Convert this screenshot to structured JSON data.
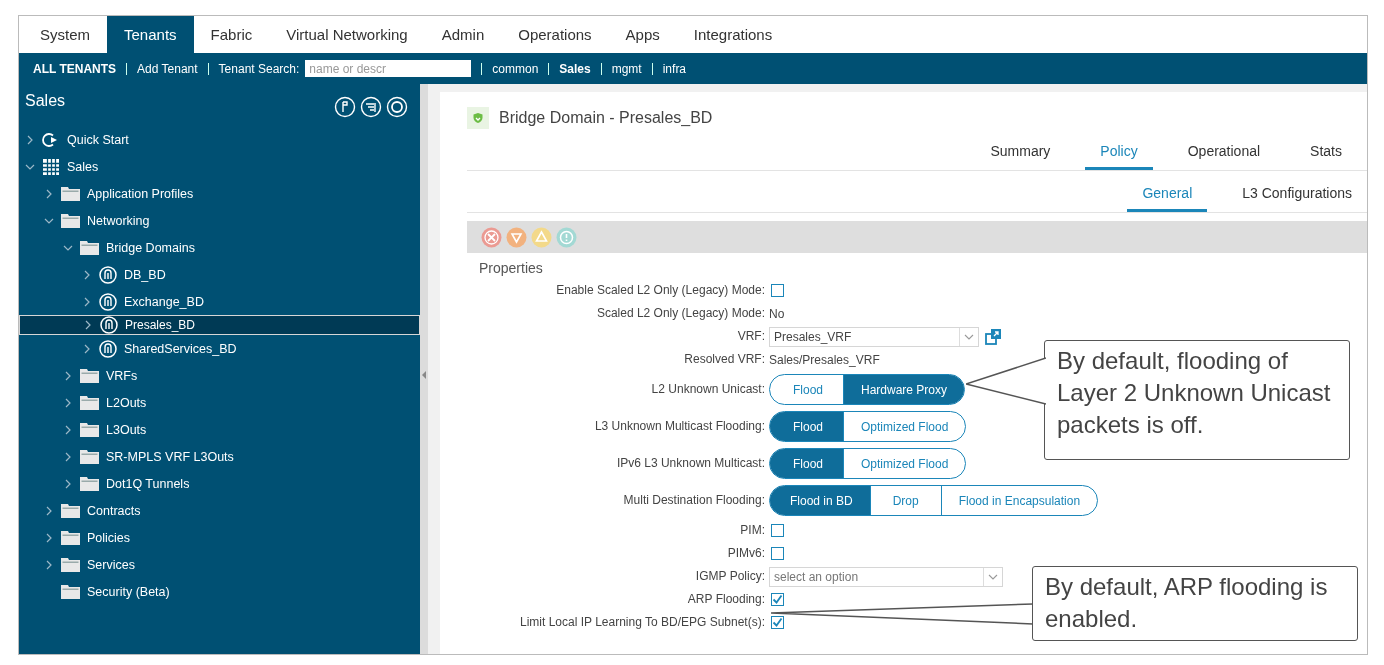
{
  "top_tabs": [
    {
      "label": "System",
      "selected": false
    },
    {
      "label": "Tenants",
      "selected": true
    },
    {
      "label": "Fabric",
      "selected": false
    },
    {
      "label": "Virtual Networking",
      "selected": false
    },
    {
      "label": "Admin",
      "selected": false
    },
    {
      "label": "Operations",
      "selected": false
    },
    {
      "label": "Apps",
      "selected": false
    },
    {
      "label": "Integrations",
      "selected": false
    }
  ],
  "sub_bar": {
    "all_tenants": "ALL TENANTS",
    "add_tenant": "Add Tenant",
    "search_label": "Tenant Search:",
    "search_placeholder": "name or descr",
    "tenants": [
      {
        "label": "common",
        "selected": false
      },
      {
        "label": "Sales",
        "selected": true
      },
      {
        "label": "mgmt",
        "selected": false
      },
      {
        "label": "infra",
        "selected": false
      }
    ]
  },
  "sidebar": {
    "title": "Sales",
    "tree": [
      {
        "label": "Quick Start",
        "kind": "quickstart",
        "expanded": false,
        "selected": false
      },
      {
        "label": "Sales",
        "kind": "tenant",
        "expanded": true,
        "selected": false,
        "children": [
          {
            "label": "Application Profiles",
            "kind": "folder",
            "expanded": false,
            "selected": false
          },
          {
            "label": "Networking",
            "kind": "folder",
            "expanded": true,
            "selected": false,
            "children": [
              {
                "label": "Bridge Domains",
                "kind": "folder",
                "expanded": true,
                "selected": false,
                "children": [
                  {
                    "label": "DB_BD",
                    "kind": "bd",
                    "expanded": false,
                    "selected": false
                  },
                  {
                    "label": "Exchange_BD",
                    "kind": "bd",
                    "expanded": false,
                    "selected": false
                  },
                  {
                    "label": "Presales_BD",
                    "kind": "bd",
                    "expanded": false,
                    "selected": true
                  },
                  {
                    "label": "SharedServices_BD",
                    "kind": "bd",
                    "expanded": false,
                    "selected": false
                  }
                ]
              },
              {
                "label": "VRFs",
                "kind": "folder",
                "expanded": false,
                "selected": false
              },
              {
                "label": "L2Outs",
                "kind": "folder",
                "expanded": false,
                "selected": false
              },
              {
                "label": "L3Outs",
                "kind": "folder",
                "expanded": false,
                "selected": false
              },
              {
                "label": "SR-MPLS VRF L3Outs",
                "kind": "folder",
                "expanded": false,
                "selected": false
              },
              {
                "label": "Dot1Q Tunnels",
                "kind": "folder",
                "expanded": false,
                "selected": false
              }
            ]
          },
          {
            "label": "Contracts",
            "kind": "folder",
            "expanded": false,
            "selected": false
          },
          {
            "label": "Policies",
            "kind": "folder",
            "expanded": false,
            "selected": false
          },
          {
            "label": "Services",
            "kind": "folder",
            "expanded": false,
            "selected": false
          },
          {
            "label": "Security (Beta)",
            "kind": "folder",
            "selected": false
          }
        ]
      }
    ]
  },
  "panel": {
    "title": "Bridge Domain - Presales_BD",
    "tabs": [
      {
        "label": "Summary",
        "selected": false
      },
      {
        "label": "Policy",
        "selected": true
      },
      {
        "label": "Operational",
        "selected": false
      },
      {
        "label": "Stats",
        "selected": false
      }
    ],
    "subtabs": [
      {
        "label": "General",
        "selected": true
      },
      {
        "label": "L3 Configurations",
        "selected": false
      }
    ],
    "section": "Properties",
    "fields": [
      {
        "kind": "checkbox",
        "label": "Enable Scaled L2 Only (Legacy) Mode:",
        "checked": false
      },
      {
        "kind": "text",
        "label": "Scaled L2 Only (Legacy) Mode:",
        "value": "No"
      },
      {
        "kind": "select",
        "label": "VRF:",
        "value": "Presales_VRF",
        "link": true
      },
      {
        "kind": "text",
        "label": "Resolved VRF:",
        "value": "Sales/Presales_VRF"
      },
      {
        "kind": "segmented",
        "label": "L2 Unknown Unicast:",
        "options": [
          {
            "label": "Flood",
            "selected": false
          },
          {
            "label": "Hardware Proxy",
            "selected": true
          }
        ]
      },
      {
        "kind": "segmented",
        "label": "L3 Unknown Multicast Flooding:",
        "options": [
          {
            "label": "Flood",
            "selected": true
          },
          {
            "label": "Optimized Flood",
            "selected": false
          }
        ]
      },
      {
        "kind": "segmented",
        "label": "IPv6 L3 Unknown Multicast:",
        "options": [
          {
            "label": "Flood",
            "selected": true
          },
          {
            "label": "Optimized Flood",
            "selected": false
          }
        ]
      },
      {
        "kind": "segmented",
        "label": "Multi Destination Flooding:",
        "options": [
          {
            "label": "Flood in BD",
            "selected": true
          },
          {
            "label": "Drop",
            "selected": false
          },
          {
            "label": "Flood in Encapsulation",
            "selected": false
          }
        ]
      },
      {
        "kind": "checkbox",
        "label": "PIM:",
        "checked": false
      },
      {
        "kind": "checkbox",
        "label": "PIMv6:",
        "checked": false
      },
      {
        "kind": "select",
        "label": "IGMP Policy:",
        "placeholder": "select an option",
        "link": false
      },
      {
        "kind": "checkbox",
        "label": "ARP Flooding:",
        "checked": true
      },
      {
        "kind": "checkbox",
        "label": "Limit Local IP Learning To BD/EPG Subnet(s):",
        "checked": true
      }
    ]
  },
  "callouts": [
    {
      "text": "By default, flooding of Layer 2 Unknown Unicast packets is off."
    },
    {
      "text": "By default, ARP flooding is enabled."
    }
  ]
}
